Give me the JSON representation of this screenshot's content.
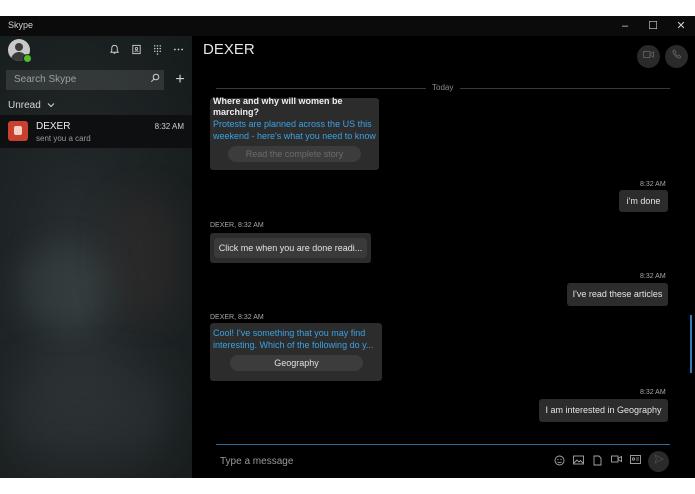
{
  "window": {
    "title": "Skype",
    "minimize_glyph": "–",
    "maximize_glyph": "☐",
    "close_glyph": "✕"
  },
  "sidebar": {
    "search_placeholder": "Search Skype",
    "filter_label": "Unread",
    "icons": [
      "bell-icon",
      "contacts-icon",
      "dialpad-icon",
      "more-icon"
    ],
    "chats": [
      {
        "name": "DEXER",
        "subtitle": "sent you a card",
        "time": "8:32 AM"
      }
    ]
  },
  "main": {
    "chat_name": "DEXER",
    "date_divider": "Today",
    "card1": {
      "title": "Where and why will women be marching?",
      "description": "Protests are planned across the US this weekend - here's what you need to know",
      "button": "Read the complete story"
    },
    "messages": [
      {
        "time": "8:32 AM",
        "text": "i'm done"
      },
      {
        "sender_stamp": "DEXER, 8:32 AM",
        "text": "Click me when you are done readi..."
      },
      {
        "time": "8:32 AM",
        "text": "I've read these articles"
      },
      {
        "sender_stamp": "DEXER, 8:32 AM",
        "text": "Cool! I've something that you may find interesting. Which of the following do y...",
        "button": "Geography"
      },
      {
        "time": "8:32 AM",
        "text": "I am interested in Geography"
      }
    ],
    "composer_placeholder": "Type a message"
  },
  "colors": {
    "accent": "#2a7fc0",
    "link": "#3aa3e3",
    "presence": "#4fbf26",
    "avatar_red": "#c8412f"
  }
}
